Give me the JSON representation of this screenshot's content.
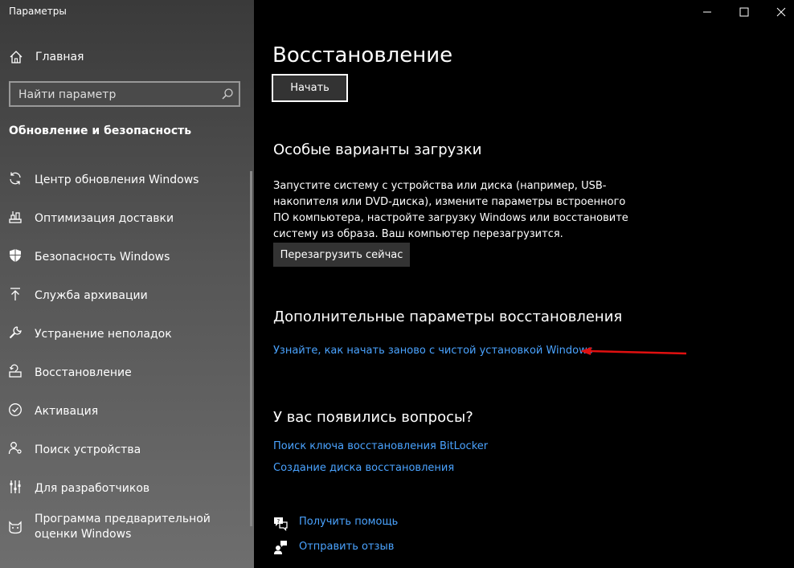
{
  "window": {
    "title": "Параметры"
  },
  "sidebar": {
    "home_label": "Главная",
    "search_placeholder": "Найти параметр",
    "section_title": "Обновление и безопасность",
    "items": [
      {
        "label": "Центр обновления Windows",
        "icon": "sync-icon"
      },
      {
        "label": "Оптимизация доставки",
        "icon": "delivery-optimization-icon"
      },
      {
        "label": "Безопасность Windows",
        "icon": "shield-icon"
      },
      {
        "label": "Служба архивации",
        "icon": "backup-arrow-up-icon"
      },
      {
        "label": "Устранение неполадок",
        "icon": "wrench-icon"
      },
      {
        "label": "Восстановление",
        "icon": "recovery-icon"
      },
      {
        "label": "Активация",
        "icon": "check-circle-icon"
      },
      {
        "label": "Поиск устройства",
        "icon": "person-location-icon"
      },
      {
        "label": "Для разработчиков",
        "icon": "developer-sliders-icon"
      },
      {
        "label": "Программа предварительной оценки Windows",
        "icon": "insider-cat-icon"
      }
    ]
  },
  "main": {
    "page_title": "Восстановление",
    "start_button": "Начать",
    "boot_heading": "Особые варианты загрузки",
    "boot_description": "Запустите систему с устройства или диска (например, USB-накопителя или DVD-диска), измените параметры встроенного ПО компьютера, настройте загрузку Windows или восстановите систему из образа. Ваш компьютер перезагрузится.",
    "restart_button": "Перезагрузить сейчас",
    "advanced_heading": "Дополнительные параметры восстановления",
    "clean_install_link": "Узнайте, как начать заново с чистой установкой Windows",
    "questions_heading": "У вас появились вопросы?",
    "bitlocker_link": "Поиск ключа восстановления BitLocker",
    "recovery_disk_link": "Создание диска восстановления",
    "help_link": "Получить помощь",
    "feedback_link": "Отправить отзыв"
  },
  "colors": {
    "link": "#4aa3ff",
    "annotation_arrow": "#e01010",
    "background": "#000000"
  }
}
